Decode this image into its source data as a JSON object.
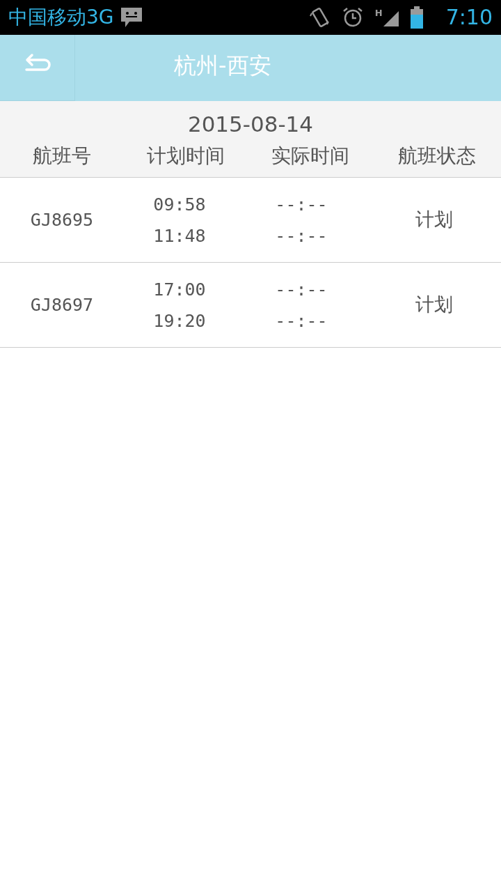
{
  "status_bar": {
    "carrier": "中国移动3G",
    "network_type": "H",
    "time": "7:10"
  },
  "header": {
    "title": "杭州-西安"
  },
  "date": "2015-08-14",
  "columns": [
    "航班号",
    "计划时间",
    "实际时间",
    "航班状态"
  ],
  "rows": [
    {
      "flight": "GJ8695",
      "planned": [
        "09:58",
        "11:48"
      ],
      "actual": [
        "--:--",
        "--:--"
      ],
      "status": "计划"
    },
    {
      "flight": "GJ8697",
      "planned": [
        "17:00",
        "19:20"
      ],
      "actual": [
        "--:--",
        "--:--"
      ],
      "status": "计划"
    }
  ]
}
